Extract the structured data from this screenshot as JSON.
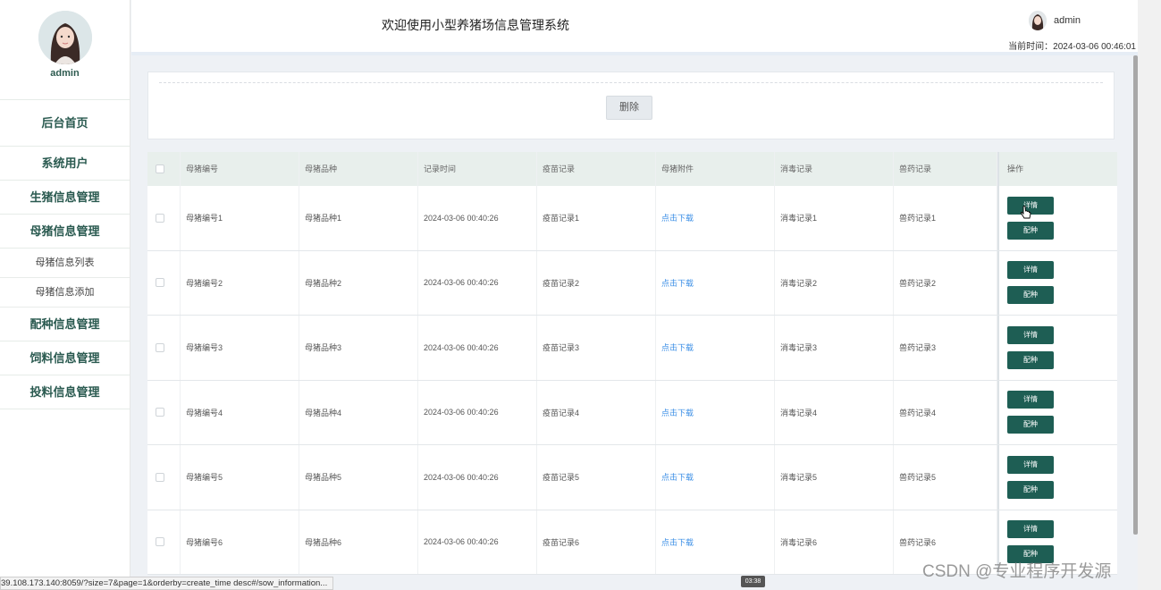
{
  "sidebar": {
    "username": "admin",
    "menu": [
      {
        "label": "后台首页"
      },
      {
        "label": "系统用户"
      },
      {
        "label": "生猪信息管理"
      },
      {
        "label": "母猪信息管理"
      }
    ],
    "submenu": [
      {
        "label": "母猪信息列表"
      },
      {
        "label": "母猪信息添加"
      }
    ],
    "menu_after": [
      {
        "label": "配种信息管理"
      },
      {
        "label": "饲料信息管理"
      },
      {
        "label": "投料信息管理"
      }
    ]
  },
  "header": {
    "title": "欢迎使用小型养猪场信息管理系统",
    "username": "admin",
    "current_time": "当前时间：2024-03-06 00:46:01"
  },
  "actions": {
    "delete_label": "删除"
  },
  "table": {
    "columns": [
      "母猪编号",
      "母猪品种",
      "记录时间",
      "疫苗记录",
      "母猪附件",
      "消毒记录",
      "兽药记录",
      "操作"
    ],
    "rows": [
      {
        "id": "母猪编号1",
        "breed": "母猪品种1",
        "time": "2024-03-06 00:40:26",
        "vaccine": "疫苗记录1",
        "attachment": "点击下载",
        "disinfect": "消毒记录1",
        "medicine": "兽药记录1"
      },
      {
        "id": "母猪编号2",
        "breed": "母猪品种2",
        "time": "2024-03-06 00:40:26",
        "vaccine": "疫苗记录2",
        "attachment": "点击下载",
        "disinfect": "消毒记录2",
        "medicine": "兽药记录2"
      },
      {
        "id": "母猪编号3",
        "breed": "母猪品种3",
        "time": "2024-03-06 00:40:26",
        "vaccine": "疫苗记录3",
        "attachment": "点击下载",
        "disinfect": "消毒记录3",
        "medicine": "兽药记录3"
      },
      {
        "id": "母猪编号4",
        "breed": "母猪品种4",
        "time": "2024-03-06 00:40:26",
        "vaccine": "疫苗记录4",
        "attachment": "点击下载",
        "disinfect": "消毒记录4",
        "medicine": "兽药记录4"
      },
      {
        "id": "母猪编号5",
        "breed": "母猪品种5",
        "time": "2024-03-06 00:40:26",
        "vaccine": "疫苗记录5",
        "attachment": "点击下载",
        "disinfect": "消毒记录5",
        "medicine": "兽药记录5"
      },
      {
        "id": "母猪编号6",
        "breed": "母猪品种6",
        "time": "2024-03-06 00:40:26",
        "vaccine": "疫苗记录6",
        "attachment": "点击下载",
        "disinfect": "消毒记录6",
        "medicine": "兽药记录6"
      }
    ],
    "detail_label": "详情",
    "breed_label": "配种"
  },
  "status_bar": {
    "url": "39.108.173.140:8059/?size=7&page=1&orderby=create_time desc#/sow_information..."
  },
  "video_time": "03:38",
  "watermark": "CSDN @专业程序开发源",
  "colors": {
    "accent": "#1e5e54",
    "link": "#3a8ee6",
    "menu_text": "#2a5a50"
  }
}
